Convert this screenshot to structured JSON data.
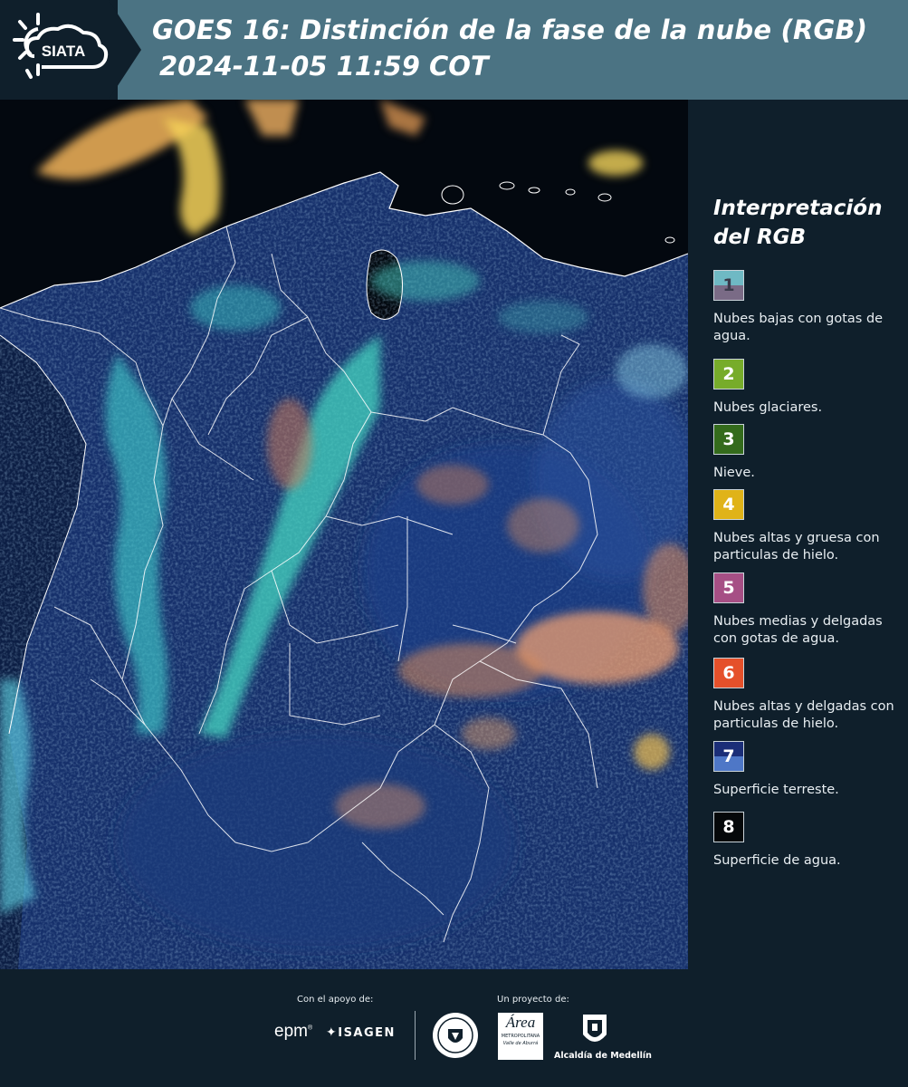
{
  "header": {
    "logo_text": "SIATA",
    "title_line1": "GOES 16: Distinción de la fase de la nube (RGB)",
    "title_line2": "2024-11-05 11:59 COT"
  },
  "legend": {
    "title": "Interpretación del RGB",
    "items": [
      {
        "number": "1",
        "color_top": "#6fb9c4",
        "color_bottom": "#7a6b86",
        "label": "Nubes bajas con gotas de agua."
      },
      {
        "number": "2",
        "color_top": "#77ac2a",
        "color_bottom": "#77ac2a",
        "label": "Nubes glaciares."
      },
      {
        "number": "3",
        "color_top": "#346b1c",
        "color_bottom": "#346b1c",
        "label": "Nieve."
      },
      {
        "number": "4",
        "color_top": "#e0b318",
        "color_bottom": "#e0b318",
        "label": "Nubes altas y gruesa con particulas de hielo."
      },
      {
        "number": "5",
        "color_top": "#a64f85",
        "color_bottom": "#a64f85",
        "label": "Nubes medias y delgadas con gotas de agua."
      },
      {
        "number": "6",
        "color_top": "#e5502a",
        "color_bottom": "#e5502a",
        "label": "Nubes altas y delgadas con particulas de hielo."
      },
      {
        "number": "7",
        "color_top": "#1b2e78",
        "color_bottom": "#4e77c7",
        "label": "Superficie terreste."
      },
      {
        "number": "8",
        "color_top": "#05080a",
        "color_bottom": "#05080a",
        "label": "Superficie de agua."
      }
    ]
  },
  "footer": {
    "support_caption": "Con el apoyo de:",
    "project_caption": "Un proyecto de:",
    "sponsor1": "epm",
    "sponsor2": "ISAGEN",
    "partner_area_main": "Área",
    "partner_area_sub": "METROPOLITANA",
    "partner_area_sub2": "Valle de Aburrá",
    "partner_alcaldia": "Alcaldía de Medellín"
  },
  "map": {
    "product": "GOES 16 cloud phase distinction RGB",
    "colors": {
      "land": "#1b3a7a",
      "ocean": "#03080f",
      "cloud_low": "#4fe0d0",
      "cloud_high": "#e8a05a",
      "cloud_thick": "#f2d36a",
      "border": "#ffffff"
    }
  }
}
